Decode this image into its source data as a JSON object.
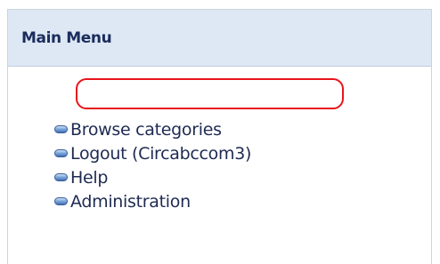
{
  "menu": {
    "title": "Main Menu",
    "items": [
      {
        "label": "Browse categories",
        "icon": "bullet-icon"
      },
      {
        "label": "Logout (Circabccom3)",
        "icon": "bullet-icon",
        "highlighted": true
      },
      {
        "label": "Help",
        "icon": "bullet-icon"
      },
      {
        "label": "Administration",
        "icon": "bullet-icon"
      }
    ],
    "colors": {
      "header_bg": "#dde8f4",
      "title": "#1b2c5c",
      "link": "#1e2a52",
      "highlight": "#e8141a",
      "border": "#c9d4df"
    }
  }
}
